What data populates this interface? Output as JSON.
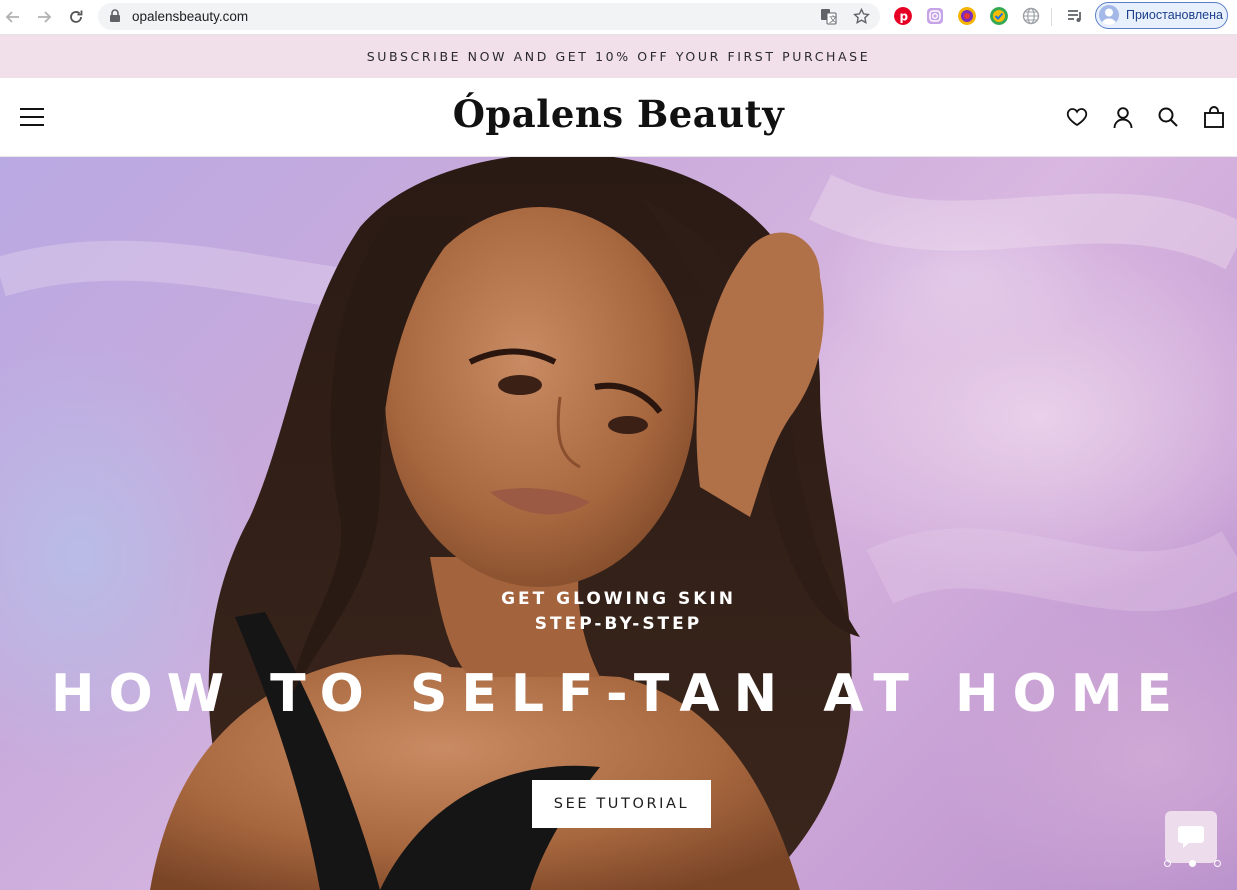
{
  "browser": {
    "url": "opalensbeauty.com",
    "profile_label": "Приостановлена"
  },
  "announcement": {
    "text": "SUBSCRIBE NOW AND GET 10% OFF YOUR FIRST PURCHASE"
  },
  "header": {
    "logo_text": "Ópalens Beauty",
    "icons": [
      "menu-icon",
      "heart-icon",
      "account-icon",
      "search-icon",
      "bag-icon"
    ]
  },
  "hero": {
    "subtitle_line1": "GET GLOWING SKIN",
    "subtitle_line2": "STEP-BY-STEP",
    "title": "HOW TO SELF-TAN AT HOME",
    "cta_label": "SEE TUTORIAL",
    "slides_total": 3,
    "active_slide": 2
  },
  "colors": {
    "announcement_bg": "#f1dfea",
    "hero_bg": "#c9aadb",
    "profile_border": "#5a7fc8",
    "text_dark": "#111111"
  }
}
